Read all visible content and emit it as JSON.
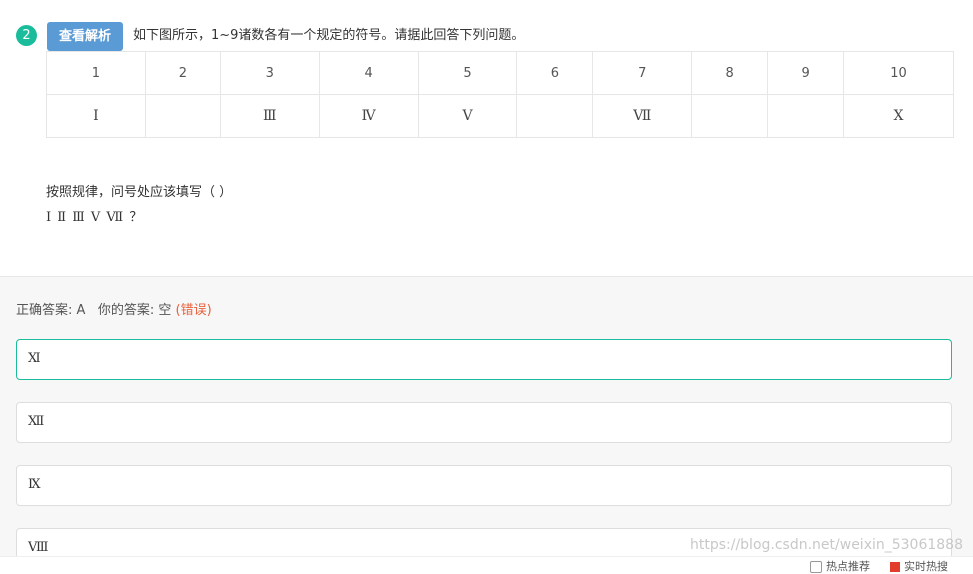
{
  "question": {
    "number": "2",
    "analysis_button": "查看解析",
    "text": "如下图所示，1~9诸数各有一个规定的符号。请据此回答下列问题。"
  },
  "table": {
    "numbers": [
      "1",
      "2",
      "3",
      "4",
      "5",
      "6",
      "7",
      "8",
      "9",
      "10"
    ],
    "symbols": [
      "Ⅰ",
      "",
      "Ⅲ",
      "Ⅳ",
      "Ⅴ",
      "",
      "Ⅶ",
      "",
      "",
      "Ⅹ"
    ]
  },
  "prompt": "按照规律，问号处应该填写（ ）",
  "sequence": "Ⅰ Ⅱ Ⅲ Ⅴ Ⅶ ？",
  "result": {
    "correct_label": "正确答案:",
    "correct_value": "A",
    "yours_label": "你的答案:",
    "yours_value": "空",
    "status": "(错误)"
  },
  "options": [
    {
      "text": "Ⅺ"
    },
    {
      "text": "Ⅻ"
    },
    {
      "text": "Ⅸ"
    },
    {
      "text": "Ⅷ"
    }
  ],
  "watermark": "https://blog.csdn.net/weixin_53061888",
  "footer": {
    "hot_recommend": "热点推荐",
    "realtime_hot": "实时热搜"
  },
  "colors": {
    "accent": "#1abc9c",
    "button": "#5b9bd5",
    "error": "#e8603c"
  }
}
